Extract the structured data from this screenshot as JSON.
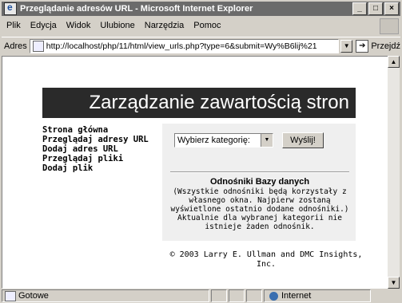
{
  "window": {
    "title": "Przeglądanie adresów URL - Microsoft Internet Explorer",
    "minimize": "_",
    "maximize": "□",
    "close": "×"
  },
  "menu": [
    "Plik",
    "Edycja",
    "Widok",
    "Ulubione",
    "Narzędzia",
    "Pomoc"
  ],
  "address": {
    "label": "Adres",
    "url": "http://localhost/php/11/html/view_urls.php?type=6&submit=Wy%B6lij%21",
    "go": "Przejdź"
  },
  "page": {
    "banner": "Zarządzanie zawartością stron",
    "nav": [
      "Strona główna",
      "Przeglądaj adresy URL",
      "Dodaj adres URL",
      "Przeglądaj pliki",
      "Dodaj plik"
    ],
    "select_value": "Wybierz kategorię:",
    "submit": "Wyślij!",
    "links_title": "Odnośniki Bazy danych",
    "links_text_1": "(Wszystkie odnośniki będą korzystały z",
    "links_text_2": "własnego okna. Najpierw zostaną",
    "links_text_3": "wyświetlone ostatnio dodane odnośniki.)",
    "links_text_4": "Aktualnie dla wybranej kategorii nie",
    "links_text_5": "istnieje żaden odnośnik.",
    "copyright_1": "© 2003 Larry E. Ullman and DMC Insights,",
    "copyright_2": "Inc."
  },
  "status": {
    "text": "Gotowe",
    "zone": "Internet"
  }
}
